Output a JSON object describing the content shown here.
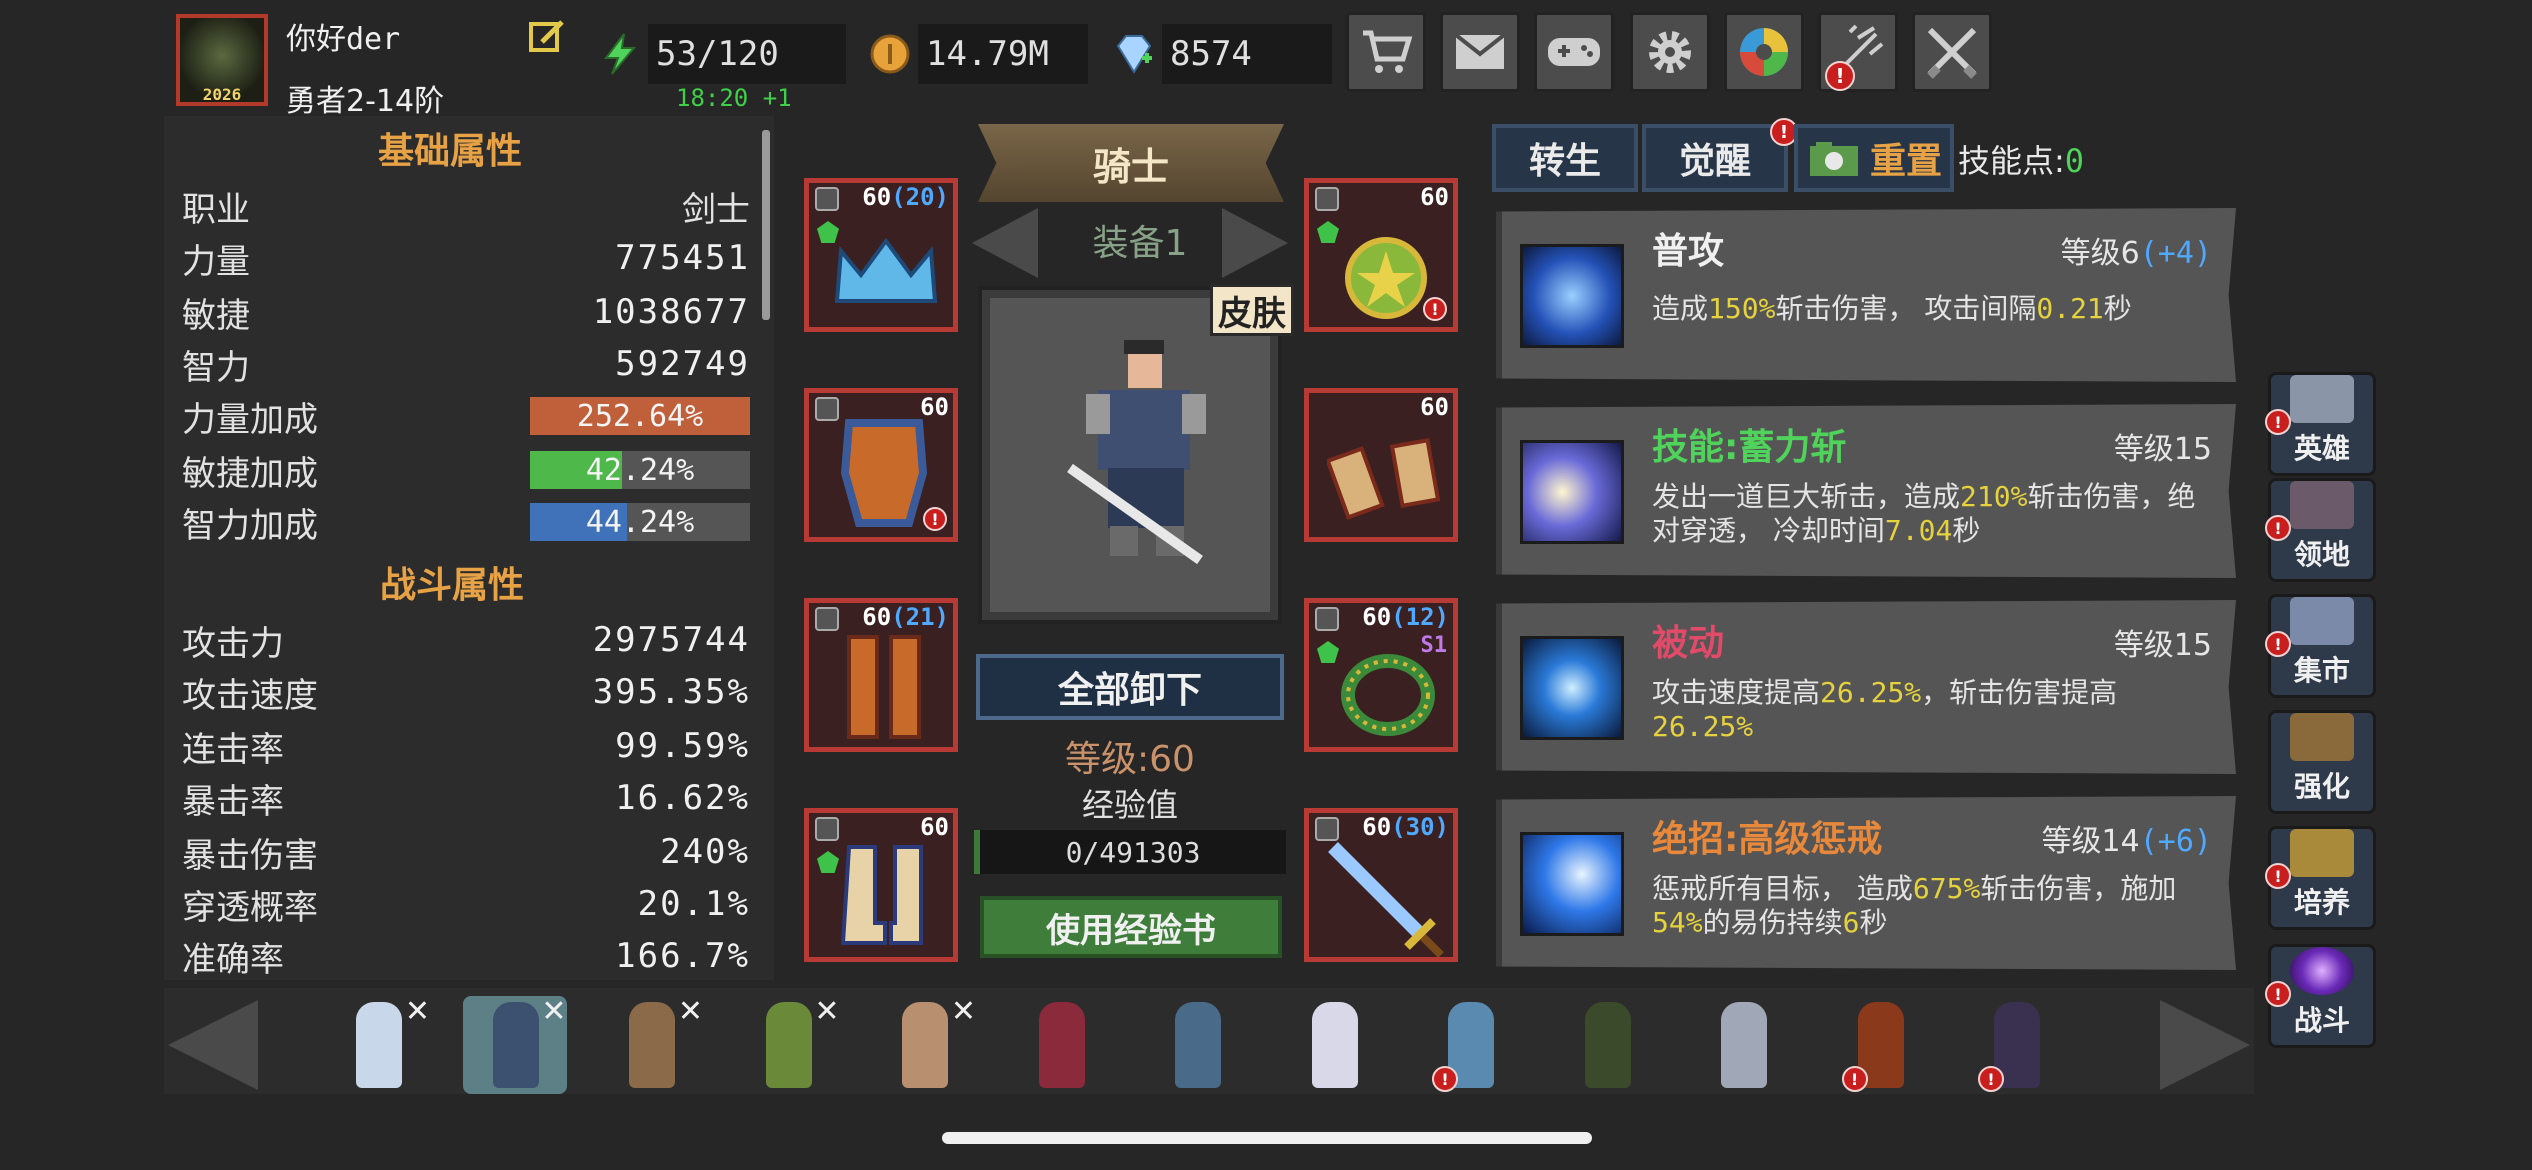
{
  "player": {
    "name": "你好der",
    "rank": "勇者2-14阶",
    "avatar_year": "2026"
  },
  "resources": {
    "energy": "53/120",
    "energy_timer": "18:20 +1",
    "gold": "14.79M",
    "diamond": "8574"
  },
  "top_buttons": [
    {
      "icon": "cart-icon"
    },
    {
      "icon": "mail-icon"
    },
    {
      "icon": "gamepad-icon"
    },
    {
      "icon": "gear-icon"
    },
    {
      "icon": "color-wheel-icon"
    },
    {
      "icon": "firework-icon",
      "alert": "!"
    },
    {
      "icon": "crossed-swords-icon"
    }
  ],
  "basic_stats": {
    "title": "基础属性",
    "rows": [
      {
        "label": "职业",
        "value": "剑士"
      },
      {
        "label": "力量",
        "value": "775451"
      },
      {
        "label": "敏捷",
        "value": "1038677"
      },
      {
        "label": "智力",
        "value": "592749"
      }
    ],
    "bonus_rows": [
      {
        "label": "力量加成",
        "value": "252.64%",
        "fill": 1.0,
        "color": "#c0603a"
      },
      {
        "label": "敏捷加成",
        "value": "42.24%",
        "fill": 0.42,
        "color": "#4fb84a"
      },
      {
        "label": "智力加成",
        "value": "44.24%",
        "fill": 0.44,
        "color": "#3f72b8"
      }
    ]
  },
  "combat_stats": {
    "title": "战斗属性",
    "rows": [
      {
        "label": "攻击力",
        "value": "2975744"
      },
      {
        "label": "攻击速度",
        "value": "395.35%"
      },
      {
        "label": "连击率",
        "value": "99.59%"
      },
      {
        "label": "暴击率",
        "value": "16.62%"
      },
      {
        "label": "暴击伤害",
        "value": "240%"
      },
      {
        "label": "穿透概率",
        "value": "20.1%"
      },
      {
        "label": "准确率",
        "value": "166.7%"
      }
    ]
  },
  "hero_panel": {
    "class_name": "骑士",
    "equip_set": "装备1",
    "skin_label": "皮肤",
    "unequip_all": "全部卸下",
    "level": "等级:60",
    "exp_label": "经验值",
    "exp_value": "0/491303",
    "use_exp_book": "使用经验书"
  },
  "equipment": [
    {
      "slot": "crown",
      "level": "60",
      "plus": "(20)"
    },
    {
      "slot": "amulet",
      "level": "60",
      "plus": "",
      "alert": "!"
    },
    {
      "slot": "armor",
      "level": "60",
      "plus": "",
      "alert": "!"
    },
    {
      "slot": "bracers",
      "level": "60",
      "plus": ""
    },
    {
      "slot": "greaves",
      "level": "60",
      "plus": "(21)"
    },
    {
      "slot": "ring",
      "level": "60",
      "plus": "(12)",
      "tag": "S1"
    },
    {
      "slot": "boots",
      "level": "60",
      "plus": ""
    },
    {
      "slot": "sword",
      "level": "60",
      "plus": "(30)"
    }
  ],
  "skill_tabs": {
    "rebirth": "转生",
    "awaken": "觉醒",
    "reset": "重置",
    "skill_points_label": "技能点:",
    "skill_points_value": "0"
  },
  "skills": [
    {
      "name": "普攻",
      "name_color": "#f0f0f0",
      "level": "等级6",
      "level_plus": "(+4)",
      "desc": [
        {
          "t": "造成",
          "h": false
        },
        {
          "t": "150%",
          "h": true
        },
        {
          "t": "斩击伤害， 攻击间隔",
          "h": false
        },
        {
          "t": "0.21",
          "h": true
        },
        {
          "t": "秒",
          "h": false
        }
      ]
    },
    {
      "name": "技能:蓄力斩",
      "name_color": "#4fd35a",
      "level": "等级15",
      "level_plus": "",
      "desc": [
        {
          "t": "发出一道巨大斩击，造成",
          "h": false
        },
        {
          "t": "210%",
          "h": true
        },
        {
          "t": "斩击伤害，绝对穿透， 冷却时间",
          "h": false
        },
        {
          "t": "7.04",
          "h": true
        },
        {
          "t": "秒",
          "h": false
        }
      ]
    },
    {
      "name": "被动",
      "name_color": "#e24a6a",
      "level": "等级15",
      "level_plus": "",
      "desc": [
        {
          "t": "攻击速度提高",
          "h": false
        },
        {
          "t": "26.25%",
          "h": true
        },
        {
          "t": "，斩击伤害提高",
          "h": false
        },
        {
          "t": "26.25%",
          "h": true
        }
      ]
    },
    {
      "name": "绝招:高级惩戒",
      "name_color": "#e7883a",
      "level": "等级14",
      "level_plus": "(+6)",
      "desc": [
        {
          "t": "惩戒所有目标， 造成",
          "h": false
        },
        {
          "t": "675%",
          "h": true
        },
        {
          "t": "斩击伤害，施加",
          "h": false
        },
        {
          "t": "54%",
          "h": true
        },
        {
          "t": "的易伤持续",
          "h": false
        },
        {
          "t": "6",
          "h": true
        },
        {
          "t": "秒",
          "h": false
        }
      ]
    }
  ],
  "side_nav": [
    {
      "label": "英雄",
      "icon": "helmet-icon"
    },
    {
      "label": "领地",
      "icon": "castle-icon"
    },
    {
      "label": "集市",
      "icon": "shop-icon"
    },
    {
      "label": "强化",
      "icon": "crystal-icon"
    },
    {
      "label": "培养",
      "icon": "chalice-icon"
    },
    {
      "label": "战斗",
      "icon": "portal-icon"
    }
  ],
  "heroes": [
    {
      "color": "#c8d8ea",
      "x_mark": "✕"
    },
    {
      "color": "#3c5070",
      "x_mark": "✕",
      "selected": true
    },
    {
      "color": "#8a6a48",
      "x_mark": "✕"
    },
    {
      "color": "#6a8a3a",
      "x_mark": "✕"
    },
    {
      "color": "#b89070",
      "x_mark": "✕"
    },
    {
      "color": "#8a2a3a"
    },
    {
      "color": "#4a6a8a"
    },
    {
      "color": "#d8d8e8"
    },
    {
      "color": "#5a8ab0",
      "alert": "!"
    },
    {
      "color": "#3a4a2a"
    },
    {
      "color": "#a0a8b8"
    },
    {
      "color": "#8a3a1a",
      "alert": "!"
    },
    {
      "color": "#3a3050",
      "alert": "!"
    }
  ],
  "colors": {
    "accent_orange": "#e7a245",
    "equip_border": "#b83a34",
    "green_button": "#3e7d3a",
    "highlight_yellow": "#e5d23e",
    "plus_blue": "#4fa9ff"
  }
}
